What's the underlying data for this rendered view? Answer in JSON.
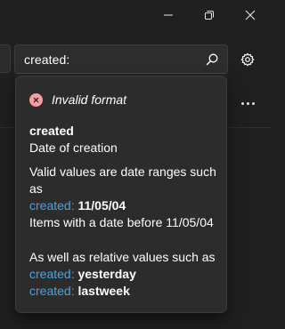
{
  "window_controls": {
    "minimize_icon": "minimize-icon",
    "maximize_icon": "restore-icon",
    "close_icon": "close-icon"
  },
  "search": {
    "value": "created:",
    "icon": "search-icon"
  },
  "settings": {
    "icon": "gear-icon"
  },
  "more": {
    "icon": "more-horizontal-icon"
  },
  "popup": {
    "error_text": "Invalid format",
    "property_name": "created",
    "property_desc": "Date of creation",
    "valid_line1": "Valid values are date ranges such",
    "valid_line2": "as",
    "example1_key": "created:",
    "example1_val": "11/05/04",
    "example1_desc": "Items with a date before 11/05/04",
    "relative_line": "As well as relative values such as",
    "example2_key": "created:",
    "example2_val": "yesterday",
    "example3_key": "created:",
    "example3_val": "lastweek"
  },
  "colors": {
    "background": "#202020",
    "popup_bg": "#2c2c2c",
    "keyword": "#4aa3df",
    "error": "#ff99a4"
  }
}
